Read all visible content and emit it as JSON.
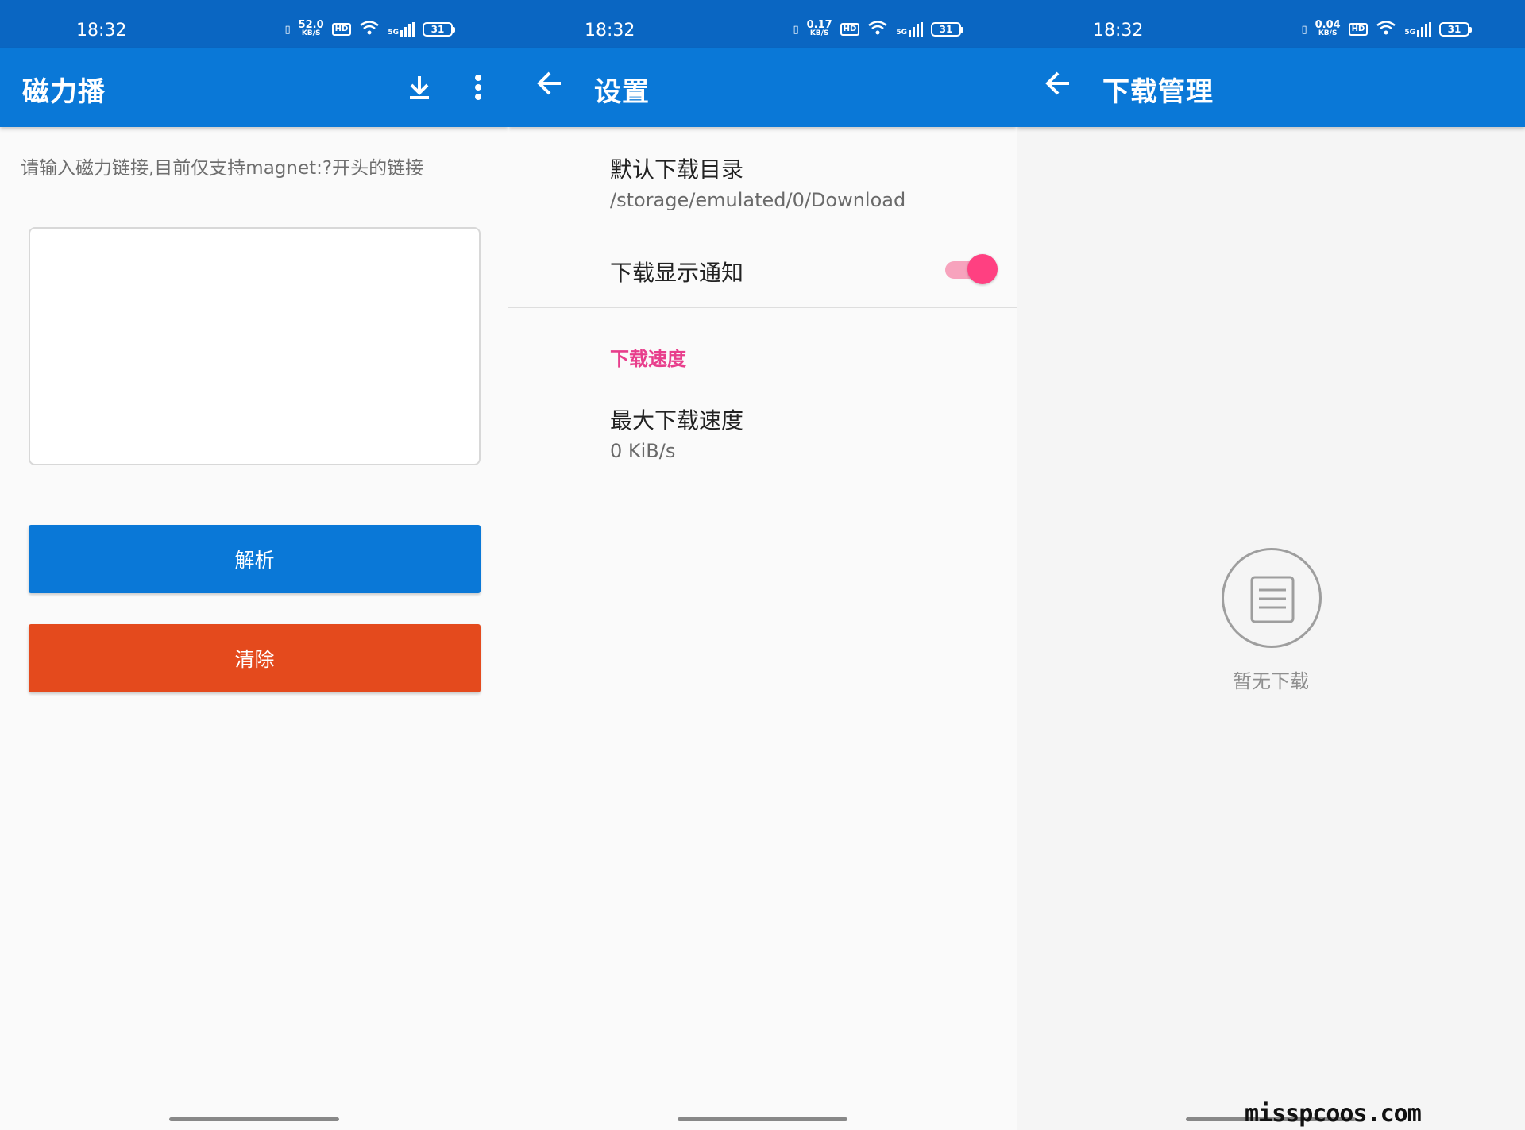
{
  "colors": {
    "statusbar": "#0a66c2",
    "appbar": "#0a78d7",
    "parse_button": "#0a78d7",
    "clear_button": "#e44a1d",
    "accent": "#ff4081",
    "section_header": "#e83e8c"
  },
  "status": {
    "time": "18:32",
    "rates": [
      {
        "value": "52.0",
        "unit": "KB/S"
      },
      {
        "value": "0.17",
        "unit": "KB/S"
      },
      {
        "value": "0.04",
        "unit": "KB/S"
      }
    ],
    "hd": "HD",
    "network": "5G",
    "battery": "31"
  },
  "main": {
    "title": "磁力播",
    "hint": "请输入磁力链接,目前仅支持magnet:?开头的链接",
    "input_value": "",
    "parse_label": "解析",
    "clear_label": "清除",
    "icons": [
      "download-icon",
      "more-vert-icon"
    ]
  },
  "settings": {
    "title": "设置",
    "default_dir_title": "默认下载目录",
    "default_dir_value": "/storage/emulated/0/Download",
    "notify_title": "下载显示通知",
    "notify_enabled": true,
    "speed_section": "下载速度",
    "max_speed_title": "最大下载速度",
    "max_speed_value": "0 KiB/s"
  },
  "downloads": {
    "title": "下载管理",
    "empty_text": "暂无下载",
    "empty_icon": "document-list-icon"
  },
  "watermark": "misspcoos.com"
}
